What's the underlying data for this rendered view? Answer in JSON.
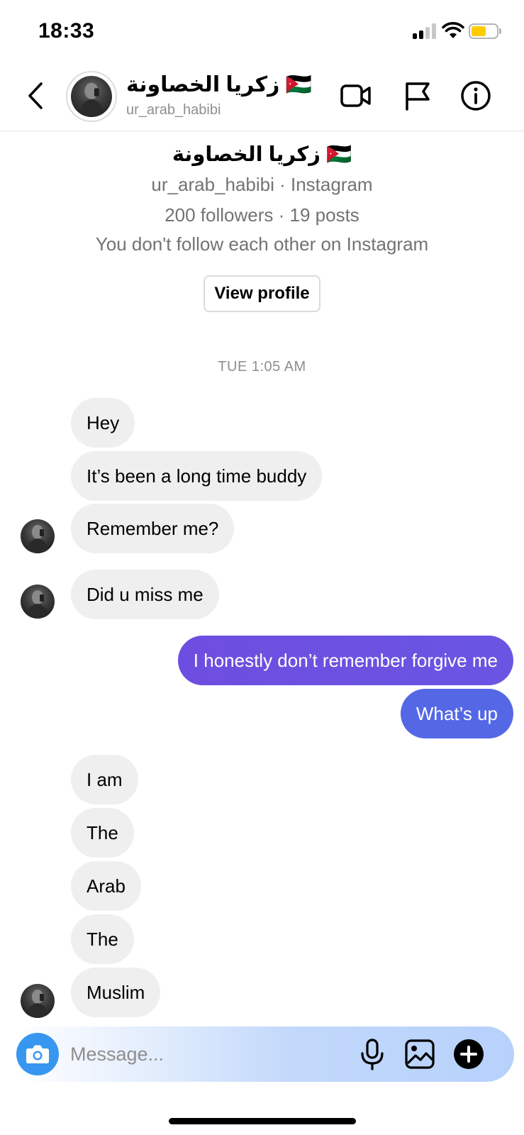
{
  "status_bar": {
    "time": "18:33"
  },
  "header": {
    "name": "زكريا الخصاونة 🇯🇴",
    "username": "ur_arab_habibi",
    "icons": [
      "back-chevron-icon",
      "video-call-icon",
      "flag-icon",
      "info-icon"
    ]
  },
  "profile_card": {
    "name": "زكريا الخصاونة 🇯🇴",
    "subtitle": "ur_arab_habibi · Instagram",
    "stats": "200 followers · 19 posts",
    "relation": "You don't follow each other on Instagram",
    "view_profile_label": "View profile"
  },
  "chat": {
    "timestamp": "TUE 1:05 AM",
    "messages": [
      {
        "from": "them",
        "text": "Hey"
      },
      {
        "from": "them",
        "text": "It’s been a long time buddy"
      },
      {
        "from": "them",
        "text": "Remember me?"
      },
      {
        "from": "them",
        "text": "Did u miss me"
      },
      {
        "from": "me",
        "text": "I honestly don’t remember forgive me"
      },
      {
        "from": "me",
        "text": "What’s up"
      },
      {
        "from": "them",
        "text": "I am"
      },
      {
        "from": "them",
        "text": "The"
      },
      {
        "from": "them",
        "text": "Arab"
      },
      {
        "from": "them",
        "text": "The"
      },
      {
        "from": "them",
        "text": "Muslim"
      }
    ]
  },
  "composer": {
    "placeholder": "Message...",
    "icons": [
      "camera-icon",
      "microphone-icon",
      "gallery-icon",
      "add-icon"
    ]
  },
  "colors": {
    "incoming_bubble": "#efefef",
    "outgoing_bubble_start": "#6e4ee0",
    "outgoing_bubble_end": "#5468e6",
    "camera_button": "#3797f0",
    "muted_text": "#8e8e8e"
  }
}
